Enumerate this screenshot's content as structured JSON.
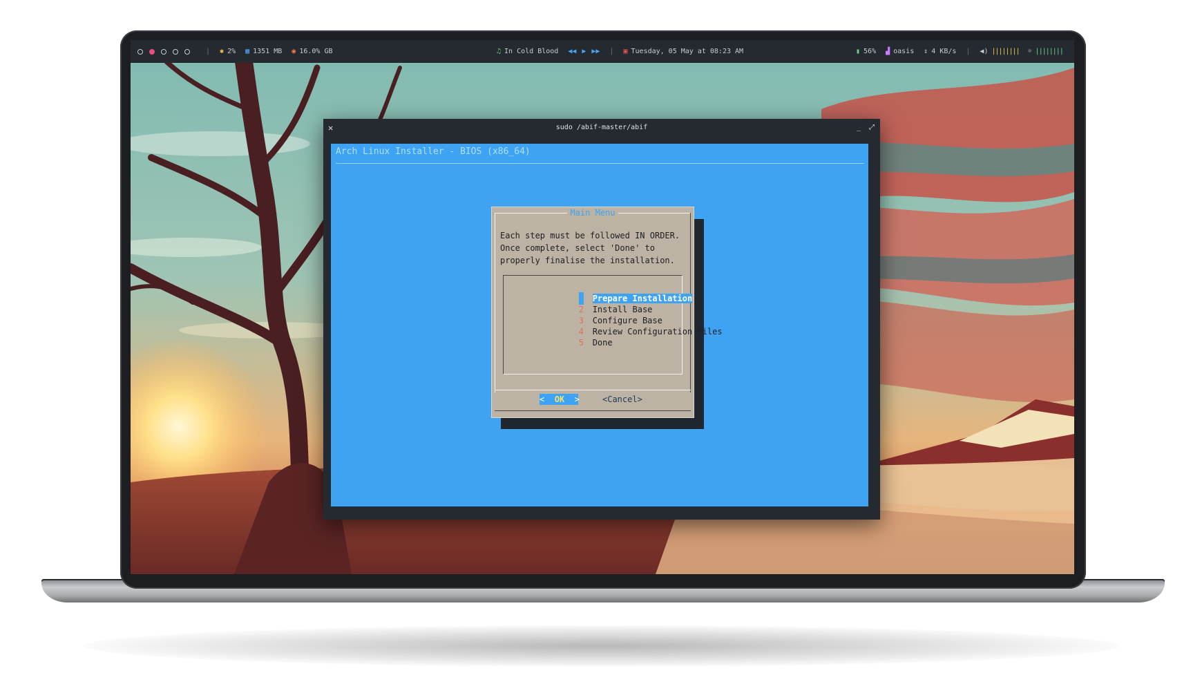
{
  "topbar": {
    "workspaces": [
      {
        "active": false
      },
      {
        "active": true
      },
      {
        "active": false
      },
      {
        "active": false
      },
      {
        "active": false
      }
    ],
    "cpu": "2%",
    "memory": "1351 MB",
    "disk": "16.0% GB",
    "music_title": "In Cold Blood",
    "datetime": "Tuesday, 05 May at 08:23 AM",
    "battery": "56%",
    "wifi": "oasis",
    "network_speed": "4 KB/s"
  },
  "window": {
    "title": "sudo /abif-master/abif"
  },
  "installer": {
    "backtitle": "Arch Linux Installer - BIOS (x86_64)",
    "dialog_title": "Main Menu",
    "text": "Each step must be followed IN ORDER.\nOnce complete, select 'Done' to\nproperly finalise the installation.",
    "menu": [
      {
        "num": "1",
        "label": "Prepare Installation",
        "selected": true
      },
      {
        "num": "2",
        "label": "Install Base",
        "selected": false
      },
      {
        "num": "3",
        "label": "Configure Base",
        "selected": false
      },
      {
        "num": "4",
        "label": "Review Configuration Files",
        "selected": false
      },
      {
        "num": "5",
        "label": "Done",
        "selected": false
      }
    ],
    "ok_label": "OK",
    "cancel_label": "<Cancel>"
  },
  "colors": {
    "terminal_bg": "#3ea3f3",
    "dialog_bg": "#bcb3a5",
    "accent_pink": "#ef4e7b",
    "bar_bg": "#252a30"
  }
}
